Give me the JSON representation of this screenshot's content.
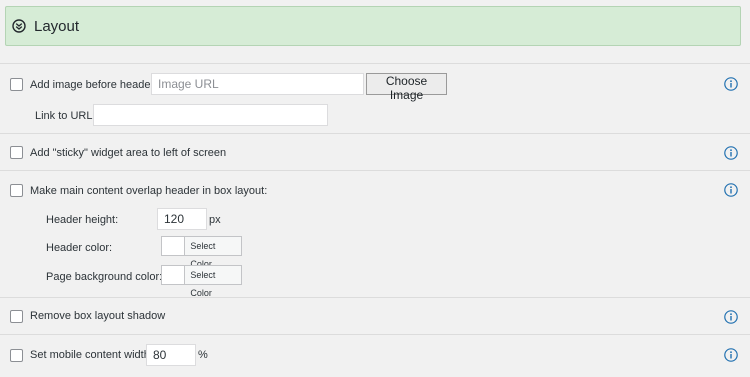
{
  "panel": {
    "title": "Layout",
    "icon": "chevron-circle-down-icon"
  },
  "header_image": {
    "label": "Add image before header:",
    "url_placeholder": "Image URL",
    "choose_button": "Choose Image",
    "link_label": "Link to URL:",
    "link_value": ""
  },
  "sticky_widget": {
    "label": "Add \"sticky\" widget area to left of screen"
  },
  "overlap": {
    "label": "Make main content overlap header in box layout:",
    "header_height_label": "Header height:",
    "header_height_value": "120",
    "header_height_unit": "px",
    "header_color_label": "Header color:",
    "header_color_button": "Select Color",
    "page_bg_label": "Page background color:",
    "page_bg_button": "Select Color"
  },
  "box_shadow": {
    "label": "Remove box layout shadow"
  },
  "mobile_width": {
    "label": "Set mobile content width:",
    "value": "80",
    "unit": "%"
  },
  "colors": {
    "header_bg": "#d6ecd6",
    "info_icon": "#2271b1"
  }
}
